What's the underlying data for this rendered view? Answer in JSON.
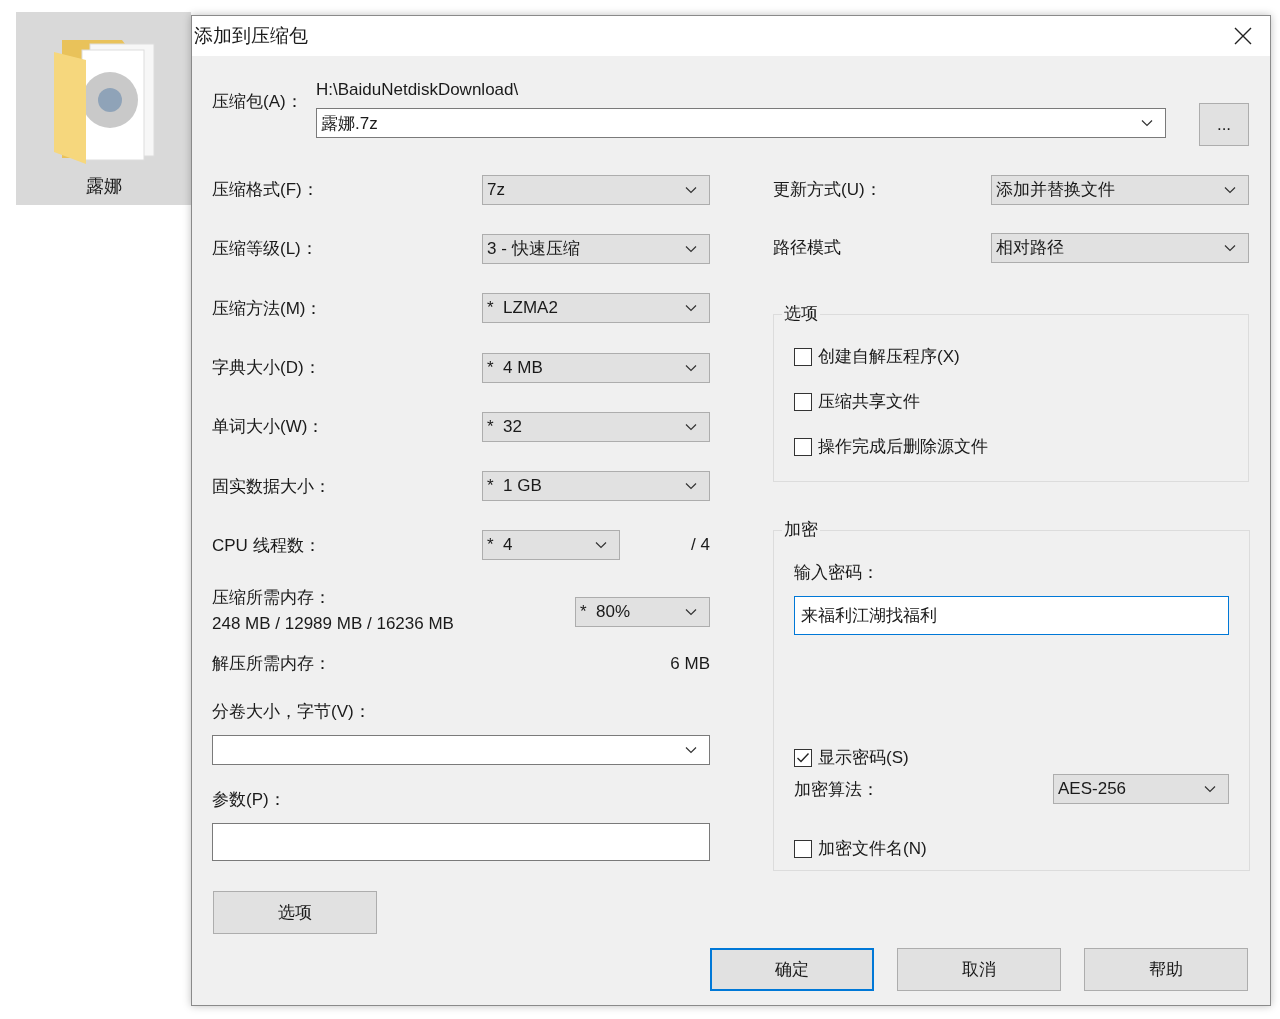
{
  "desktop_icon": {
    "label": "露娜",
    "selected": true
  },
  "window": {
    "title": "添加到压缩包"
  },
  "archive": {
    "label": "压缩包(A)：",
    "path": "H:\\BaiduNetdiskDownload\\",
    "value": "露娜.7z",
    "browse_button": "..."
  },
  "left_settings": [
    {
      "label": "压缩格式(F)：",
      "value": "7z"
    },
    {
      "label": "压缩等级(L)：",
      "value": "3 - 快速压缩"
    },
    {
      "label": "压缩方法(M)：",
      "value": "*  LZMA2"
    },
    {
      "label": "字典大小(D)：",
      "value": "*  4 MB"
    },
    {
      "label": "单词大小(W)：",
      "value": "*  32"
    },
    {
      "label": "固实数据大小：",
      "value": "*  1 GB"
    },
    {
      "label": "CPU 线程数：",
      "value": "*  4",
      "suffix": "/ 4"
    }
  ],
  "memory": {
    "label": "压缩所需内存：",
    "value": "248 MB / 12989 MB / 16236 MB",
    "percent": "*  80%"
  },
  "decompress_memory": {
    "label": "解压所需内存：",
    "value": "6 MB"
  },
  "split": {
    "label": "分卷大小，字节(V)："
  },
  "params": {
    "label": "参数(P)："
  },
  "options_button": "选项",
  "right_settings": [
    {
      "label": "更新方式(U)：",
      "value": "添加并替换文件"
    },
    {
      "label": "路径模式",
      "value": "相对路径"
    }
  ],
  "options_group": {
    "title": "选项",
    "items": [
      {
        "label": "创建自解压程序(X)",
        "checked": false
      },
      {
        "label": "压缩共享文件",
        "checked": false
      },
      {
        "label": "操作完成后删除源文件",
        "checked": false
      }
    ]
  },
  "encryption": {
    "title": "加密",
    "password_label": "输入密码：",
    "password": "来福利江湖找福利",
    "show_password": {
      "label": "显示密码(S)",
      "checked": true
    },
    "method_label": "加密算法：",
    "method": "AES-256",
    "encrypt_names": {
      "label": "加密文件名(N)",
      "checked": false
    }
  },
  "buttons": [
    {
      "label": "确定",
      "default": true
    },
    {
      "label": "取消",
      "default": false
    },
    {
      "label": "帮助",
      "default": false
    }
  ]
}
